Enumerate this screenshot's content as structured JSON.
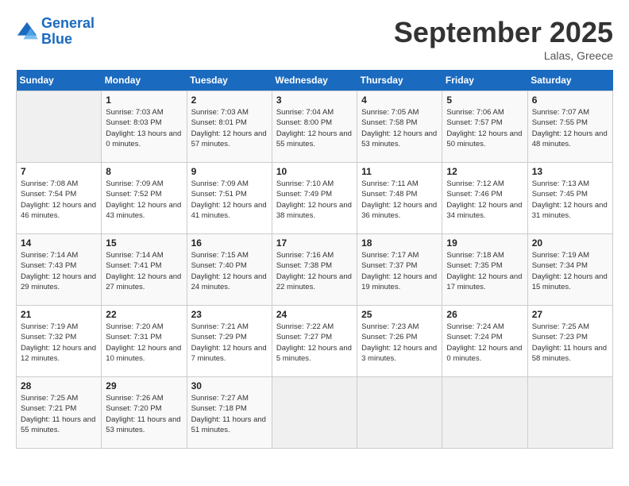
{
  "header": {
    "logo_line1": "General",
    "logo_line2": "Blue",
    "month": "September 2025",
    "location": "Lalas, Greece"
  },
  "days_of_week": [
    "Sunday",
    "Monday",
    "Tuesday",
    "Wednesday",
    "Thursday",
    "Friday",
    "Saturday"
  ],
  "weeks": [
    [
      {
        "day": "",
        "sunrise": "",
        "sunset": "",
        "daylight": ""
      },
      {
        "day": "1",
        "sunrise": "Sunrise: 7:03 AM",
        "sunset": "Sunset: 8:03 PM",
        "daylight": "Daylight: 13 hours and 0 minutes."
      },
      {
        "day": "2",
        "sunrise": "Sunrise: 7:03 AM",
        "sunset": "Sunset: 8:01 PM",
        "daylight": "Daylight: 12 hours and 57 minutes."
      },
      {
        "day": "3",
        "sunrise": "Sunrise: 7:04 AM",
        "sunset": "Sunset: 8:00 PM",
        "daylight": "Daylight: 12 hours and 55 minutes."
      },
      {
        "day": "4",
        "sunrise": "Sunrise: 7:05 AM",
        "sunset": "Sunset: 7:58 PM",
        "daylight": "Daylight: 12 hours and 53 minutes."
      },
      {
        "day": "5",
        "sunrise": "Sunrise: 7:06 AM",
        "sunset": "Sunset: 7:57 PM",
        "daylight": "Daylight: 12 hours and 50 minutes."
      },
      {
        "day": "6",
        "sunrise": "Sunrise: 7:07 AM",
        "sunset": "Sunset: 7:55 PM",
        "daylight": "Daylight: 12 hours and 48 minutes."
      }
    ],
    [
      {
        "day": "7",
        "sunrise": "Sunrise: 7:08 AM",
        "sunset": "Sunset: 7:54 PM",
        "daylight": "Daylight: 12 hours and 46 minutes."
      },
      {
        "day": "8",
        "sunrise": "Sunrise: 7:09 AM",
        "sunset": "Sunset: 7:52 PM",
        "daylight": "Daylight: 12 hours and 43 minutes."
      },
      {
        "day": "9",
        "sunrise": "Sunrise: 7:09 AM",
        "sunset": "Sunset: 7:51 PM",
        "daylight": "Daylight: 12 hours and 41 minutes."
      },
      {
        "day": "10",
        "sunrise": "Sunrise: 7:10 AM",
        "sunset": "Sunset: 7:49 PM",
        "daylight": "Daylight: 12 hours and 38 minutes."
      },
      {
        "day": "11",
        "sunrise": "Sunrise: 7:11 AM",
        "sunset": "Sunset: 7:48 PM",
        "daylight": "Daylight: 12 hours and 36 minutes."
      },
      {
        "day": "12",
        "sunrise": "Sunrise: 7:12 AM",
        "sunset": "Sunset: 7:46 PM",
        "daylight": "Daylight: 12 hours and 34 minutes."
      },
      {
        "day": "13",
        "sunrise": "Sunrise: 7:13 AM",
        "sunset": "Sunset: 7:45 PM",
        "daylight": "Daylight: 12 hours and 31 minutes."
      }
    ],
    [
      {
        "day": "14",
        "sunrise": "Sunrise: 7:14 AM",
        "sunset": "Sunset: 7:43 PM",
        "daylight": "Daylight: 12 hours and 29 minutes."
      },
      {
        "day": "15",
        "sunrise": "Sunrise: 7:14 AM",
        "sunset": "Sunset: 7:41 PM",
        "daylight": "Daylight: 12 hours and 27 minutes."
      },
      {
        "day": "16",
        "sunrise": "Sunrise: 7:15 AM",
        "sunset": "Sunset: 7:40 PM",
        "daylight": "Daylight: 12 hours and 24 minutes."
      },
      {
        "day": "17",
        "sunrise": "Sunrise: 7:16 AM",
        "sunset": "Sunset: 7:38 PM",
        "daylight": "Daylight: 12 hours and 22 minutes."
      },
      {
        "day": "18",
        "sunrise": "Sunrise: 7:17 AM",
        "sunset": "Sunset: 7:37 PM",
        "daylight": "Daylight: 12 hours and 19 minutes."
      },
      {
        "day": "19",
        "sunrise": "Sunrise: 7:18 AM",
        "sunset": "Sunset: 7:35 PM",
        "daylight": "Daylight: 12 hours and 17 minutes."
      },
      {
        "day": "20",
        "sunrise": "Sunrise: 7:19 AM",
        "sunset": "Sunset: 7:34 PM",
        "daylight": "Daylight: 12 hours and 15 minutes."
      }
    ],
    [
      {
        "day": "21",
        "sunrise": "Sunrise: 7:19 AM",
        "sunset": "Sunset: 7:32 PM",
        "daylight": "Daylight: 12 hours and 12 minutes."
      },
      {
        "day": "22",
        "sunrise": "Sunrise: 7:20 AM",
        "sunset": "Sunset: 7:31 PM",
        "daylight": "Daylight: 12 hours and 10 minutes."
      },
      {
        "day": "23",
        "sunrise": "Sunrise: 7:21 AM",
        "sunset": "Sunset: 7:29 PM",
        "daylight": "Daylight: 12 hours and 7 minutes."
      },
      {
        "day": "24",
        "sunrise": "Sunrise: 7:22 AM",
        "sunset": "Sunset: 7:27 PM",
        "daylight": "Daylight: 12 hours and 5 minutes."
      },
      {
        "day": "25",
        "sunrise": "Sunrise: 7:23 AM",
        "sunset": "Sunset: 7:26 PM",
        "daylight": "Daylight: 12 hours and 3 minutes."
      },
      {
        "day": "26",
        "sunrise": "Sunrise: 7:24 AM",
        "sunset": "Sunset: 7:24 PM",
        "daylight": "Daylight: 12 hours and 0 minutes."
      },
      {
        "day": "27",
        "sunrise": "Sunrise: 7:25 AM",
        "sunset": "Sunset: 7:23 PM",
        "daylight": "Daylight: 11 hours and 58 minutes."
      }
    ],
    [
      {
        "day": "28",
        "sunrise": "Sunrise: 7:25 AM",
        "sunset": "Sunset: 7:21 PM",
        "daylight": "Daylight: 11 hours and 55 minutes."
      },
      {
        "day": "29",
        "sunrise": "Sunrise: 7:26 AM",
        "sunset": "Sunset: 7:20 PM",
        "daylight": "Daylight: 11 hours and 53 minutes."
      },
      {
        "day": "30",
        "sunrise": "Sunrise: 7:27 AM",
        "sunset": "Sunset: 7:18 PM",
        "daylight": "Daylight: 11 hours and 51 minutes."
      },
      {
        "day": "",
        "sunrise": "",
        "sunset": "",
        "daylight": ""
      },
      {
        "day": "",
        "sunrise": "",
        "sunset": "",
        "daylight": ""
      },
      {
        "day": "",
        "sunrise": "",
        "sunset": "",
        "daylight": ""
      },
      {
        "day": "",
        "sunrise": "",
        "sunset": "",
        "daylight": ""
      }
    ]
  ]
}
